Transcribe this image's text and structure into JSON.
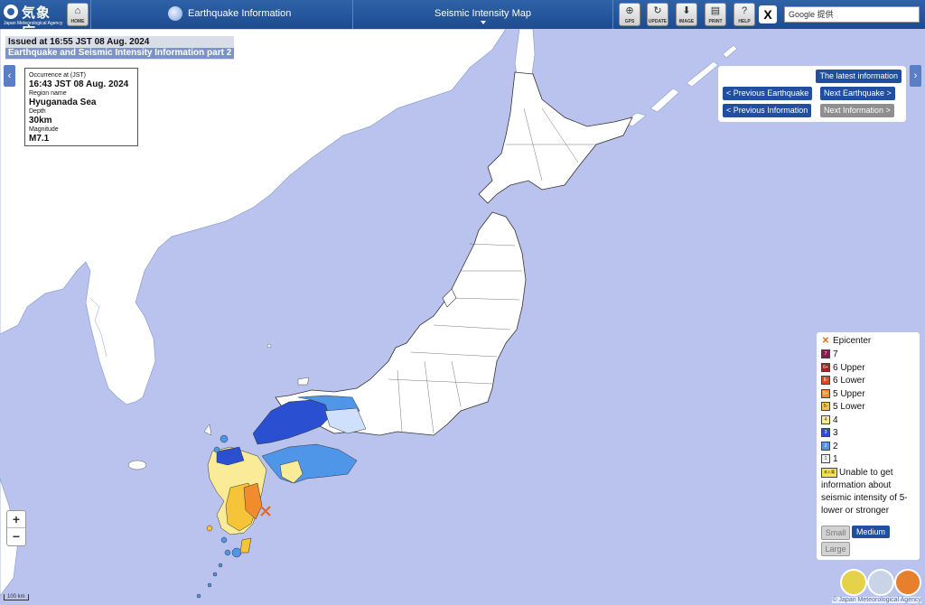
{
  "header": {
    "logo_ja": "気象庁",
    "logo_en": "Japan Meteorological Agency",
    "home_label": "HOME",
    "menu_earthquake": "Earthquake Information",
    "menu_map": "Seismic Intensity Map",
    "gps_label": "GPS",
    "update_label": "UPDATE",
    "image_label": "IMAGE",
    "print_label": "PRINT",
    "help_label": "HELP",
    "x_label": "X",
    "search_placeholder": "Google 提供"
  },
  "issued": {
    "line1": "Issued at 16:55 JST 08 Aug. 2024",
    "line2": "Earthquake and Seismic Intensity Information part 2"
  },
  "occurrence": {
    "occ_label": "Occurrence at (JST)",
    "occ_value": "16:43 JST 08 Aug. 2024",
    "region_label": "Region name",
    "region_value": "Hyuganada Sea",
    "depth_label": "Depth",
    "depth_value": "30km",
    "mag_label": "Magnitude",
    "mag_value": "M7.1"
  },
  "nav": {
    "latest": "The latest information",
    "prev_eq": "< Previous Earthquake",
    "next_eq": "Next Earthquake >",
    "prev_info": "< Previous Information",
    "next_info": "Next Information >"
  },
  "legend": {
    "epicenter": "Epicenter",
    "items": [
      {
        "label": "7",
        "box": "7",
        "color": "#8a1a4e"
      },
      {
        "label": "6 Upper",
        "box": "6+",
        "color": "#a2261c"
      },
      {
        "label": "6 Lower",
        "box": "6-",
        "color": "#e0442a"
      },
      {
        "label": "5 Upper",
        "box": "5+",
        "color": "#f08b2e"
      },
      {
        "label": "5 Lower",
        "box": "5-",
        "color": "#f5c438"
      },
      {
        "label": "4",
        "box": "4",
        "color": "#faeb98"
      },
      {
        "label": "3",
        "box": "3",
        "color": "#2a4fd1"
      },
      {
        "label": "2",
        "box": "2",
        "color": "#4f95e8"
      },
      {
        "label": "1",
        "box": "1",
        "color": "#f2f2f2"
      }
    ],
    "unable_badge": "未入電",
    "unable_text": "Unable to get information about seismic intensity of 5- lower or stronger",
    "size_small": "Small",
    "size_medium": "Medium",
    "size_large": "Large"
  },
  "map": {
    "zoom_in": "+",
    "zoom_out": "−",
    "scale": "100 km",
    "copyright": "© Japan Meteorological Agency"
  }
}
